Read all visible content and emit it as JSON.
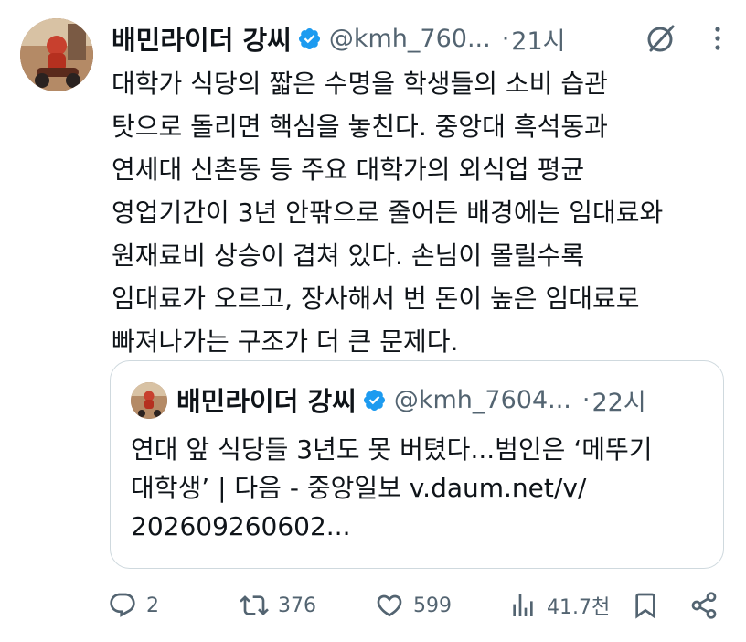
{
  "tweet": {
    "author_name": "배민라이더 강씨",
    "handle": "@kmh_760...",
    "separator": "·",
    "time": "21시",
    "text": "대학가 식당의 짧은 수명을 학생들의 소비 습관\n탓으로 돌리면 핵심을 놓친다. 중앙대 흑석동과\n연세대 신촌동 등 주요 대학가의 외식업 평균\n영업기간이 3년 안팎으로 줄어든 배경에는 임대료와\n원재료비 상승이 겹쳐 있다. 손님이 몰릴수록\n임대료가 오르고, 장사해서 번 돈이 높은 임대료로\n빠져나가는 구조가 더 큰 문제다."
  },
  "quoted": {
    "author_name": "배민라이더 강씨",
    "handle": "@kmh_7604...",
    "separator": "·",
    "time": "22시",
    "text": "연대 앞 식당들 3년도 못 버텼다...범인은 ‘메뚜기\n대학생’ | 다음 - 중앙일보 v.daum.net/v/\n202609260602..."
  },
  "actions": {
    "replies": "2",
    "reposts": "376",
    "likes": "599",
    "views": "41.7천"
  },
  "icons": {
    "verified": "verified-badge-icon",
    "grok": "grok-icon",
    "more": "more-dots-icon",
    "reply": "reply-icon",
    "repost": "repost-icon",
    "like": "heart-icon",
    "views": "views-chart-icon",
    "bookmark": "bookmark-icon",
    "share": "share-icon"
  },
  "colors": {
    "text": "#0f1419",
    "secondary": "#536471",
    "verified": "#1d9bf0",
    "border": "#cfd9de"
  }
}
